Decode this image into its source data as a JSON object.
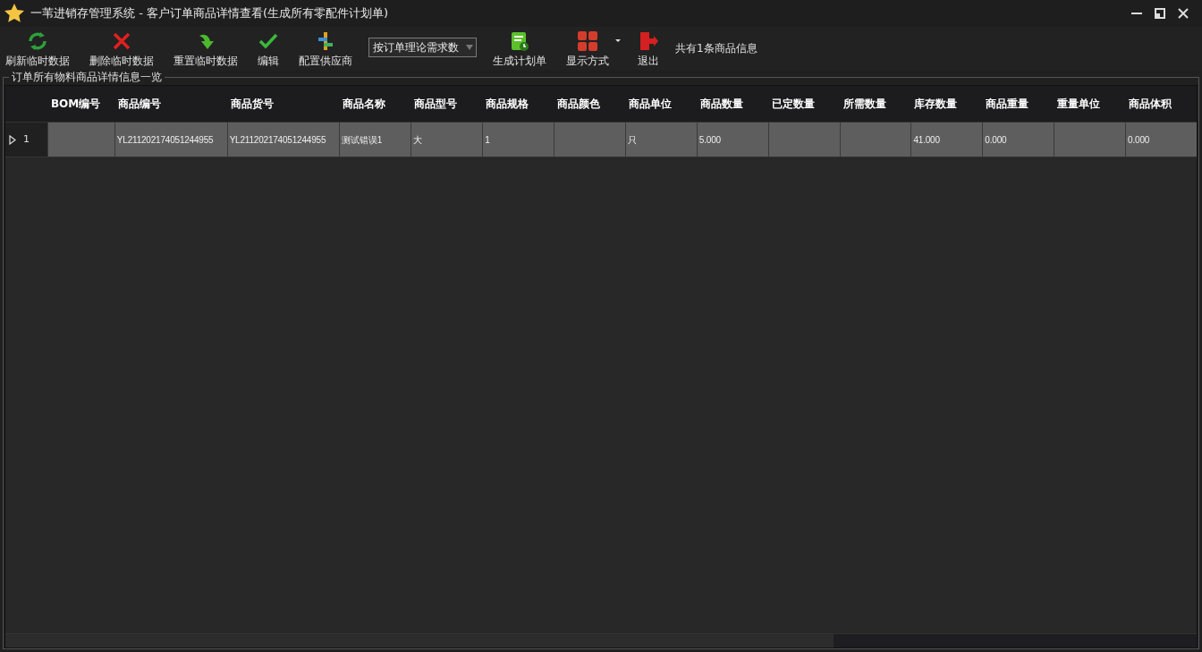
{
  "window": {
    "title": "一苇进销存管理系统 - 客户订单商品详情查看(生成所有零配件计划单)"
  },
  "toolbar": [
    {
      "kind": "button",
      "label": "刷新临时数据"
    },
    {
      "kind": "button",
      "label": "删除临时数据"
    },
    {
      "kind": "button",
      "label": "重置临时数据"
    },
    {
      "kind": "button",
      "label": "编辑"
    },
    {
      "kind": "button",
      "label": "配置供应商"
    },
    {
      "kind": "dropdown",
      "value": "按订单理论需求数"
    },
    {
      "kind": "button",
      "label": "生成计划单"
    },
    {
      "kind": "split",
      "label": "显示方式"
    },
    {
      "kind": "button",
      "label": "退出"
    },
    {
      "kind": "text",
      "label": "共有1条商品信息"
    }
  ],
  "group": {
    "title": "订单所有物料商品详情信息一览"
  },
  "table": {
    "columns": [
      "BOM编号",
      "商品编号",
      "商品货号",
      "商品名称",
      "商品型号",
      "商品规格",
      "商品颜色",
      "商品单位",
      "商品数量",
      "已定数量",
      "所需数量",
      "库存数量",
      "商品重量",
      "重量单位",
      "商品体积"
    ],
    "rows": [
      {
        "current": true,
        "number": "1",
        "cells": [
          "",
          "YL211202174051244955",
          "YL211202174051244955",
          "测试错误1",
          "大",
          "1",
          "",
          "只",
          "5.000",
          "",
          "",
          "41.000",
          "0.000",
          "",
          "0.000"
        ]
      }
    ]
  }
}
